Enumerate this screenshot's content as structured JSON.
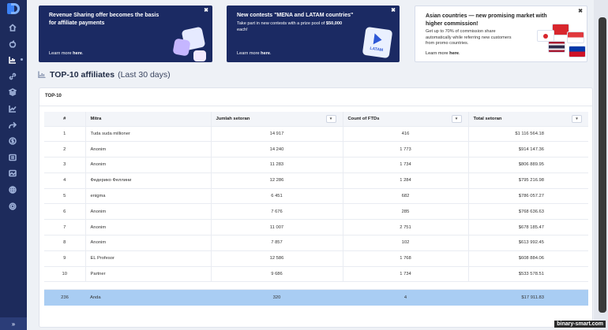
{
  "banners": [
    {
      "title": "Revenue Sharing offer becomes the basis for affiliate payments",
      "body": "",
      "body_bold": "",
      "body_end": "",
      "link_prefix": "Learn more ",
      "link": "here",
      "link_suffix": ".",
      "close": "✖"
    },
    {
      "title": "New contests \"MENA and LATAM countries\"",
      "body": "Take part in new contests with a prize pool of",
      "body_bold": "$50,000",
      "body_end": " each!",
      "badge_label": "LATAM",
      "link_prefix": "Learn more ",
      "link": "here",
      "link_suffix": ".",
      "close": "✖"
    },
    {
      "title": "Asian countries — new promising market with higher commission!",
      "body": "Get up to 70% of commission share automatically while referring new customers from promo countries.",
      "link_prefix": "Learn more ",
      "link": "here",
      "link_suffix": ".",
      "close": "✖"
    }
  ],
  "page": {
    "title": "TOP-10 affiliates",
    "subtitle": "(Last 30 days)"
  },
  "card": {
    "title": "TOP-10"
  },
  "table": {
    "columns": [
      "#",
      "Mitra",
      "Jumlah setoran",
      "Count of FTDs",
      "Total setoran"
    ],
    "sort_glyph": "▾",
    "rows": [
      [
        "1",
        "Tuda suda millioner",
        "14 917",
        "416",
        "$1 116 564.18"
      ],
      [
        "2",
        "Anonim",
        "14 240",
        "1 773",
        "$914 147.36"
      ],
      [
        "3",
        "Anonim",
        "11 283",
        "1 734",
        "$806 889.95"
      ],
      [
        "4",
        "Федерико Феллини",
        "12 286",
        "1 284",
        "$795 216.98"
      ],
      [
        "5",
        "enigma",
        "6 451",
        "682",
        "$786 057.27"
      ],
      [
        "6",
        "Anonim",
        "7 676",
        "285",
        "$768 636.63"
      ],
      [
        "7",
        "Anonim",
        "11 007",
        "2 751",
        "$678 185.47"
      ],
      [
        "8",
        "Anonim",
        "7 857",
        "102",
        "$613 992.45"
      ],
      [
        "9",
        "EL Profesor",
        "12 586",
        "1 768",
        "$608 884.06"
      ],
      [
        "10",
        "Partner",
        "9 686",
        "1 734",
        "$533 578.51"
      ]
    ],
    "you_row": [
      "236",
      "Anda",
      "320",
      "4",
      "$17 911.83"
    ]
  },
  "sidebar": {
    "collapse": "»",
    "icons": [
      "home-icon",
      "apple-icon",
      "chart-icon",
      "link-icon",
      "layers-icon",
      "stats-icon",
      "share-icon",
      "dollar-icon",
      "list-icon",
      "image-icon",
      "globe-icon"
    ]
  },
  "watermark": "binary-smart.com",
  "colors": {
    "sidebar": "#1d2b5c",
    "banner_dark": "#1b2a63",
    "highlight_row": "#a9cdf3",
    "accent": "#3b82f6"
  }
}
